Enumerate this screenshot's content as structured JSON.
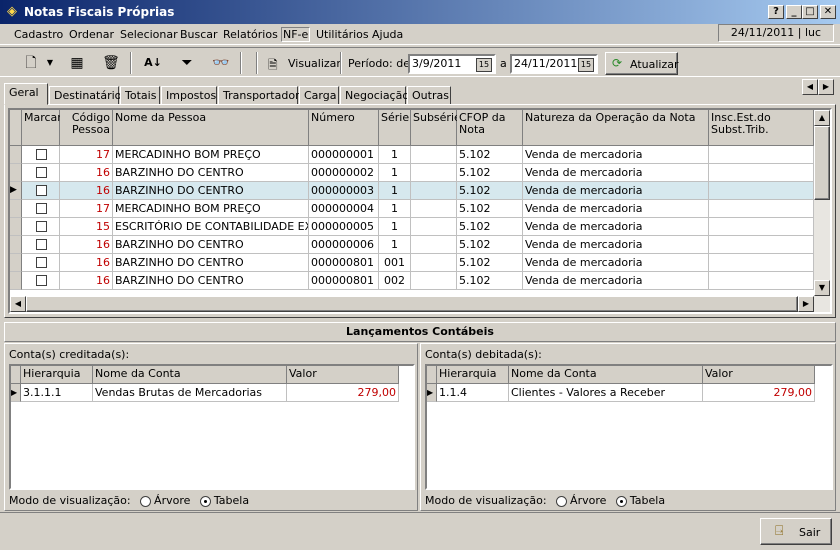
{
  "window": {
    "title": "Notas Fiscais Próprias",
    "status": "24/11/2011 | luc"
  },
  "menu": [
    "Cadastro",
    "Ordenar",
    "Selecionar",
    "Buscar",
    "Relatórios",
    "NF-e",
    "Utilitários",
    "Ajuda"
  ],
  "toolbar": {
    "visualizar": "Visualizar",
    "periodo_label": "Período: de",
    "date_from": "3/9/2011",
    "a_label": "a",
    "date_to": "24/11/2011",
    "atualizar": "Atualizar"
  },
  "tabs": [
    "Geral",
    "Destinatário",
    "Totais",
    "Impostos",
    "Transportador",
    "Carga",
    "Negociação",
    "Outras"
  ],
  "grid": {
    "headers": {
      "marcar": "Marcar",
      "codigo": "Código Pessoa",
      "nome": "Nome da Pessoa",
      "numero": "Número",
      "serie": "Série",
      "subserie": "Subsérie",
      "cfop": "CFOP da Nota",
      "natureza": "Natureza da Operação da Nota",
      "insc": "Insc.Est.do Subst.Trib."
    },
    "rows": [
      {
        "codigo": "17",
        "nome": "MERCADINHO BOM PREÇO",
        "numero": "000000001",
        "serie": "1",
        "subserie": "",
        "cfop": "5.102",
        "natureza": "Venda de mercadoria"
      },
      {
        "codigo": "16",
        "nome": "BARZINHO DO CENTRO",
        "numero": "000000002",
        "serie": "1",
        "subserie": "",
        "cfop": "5.102",
        "natureza": "Venda de mercadoria"
      },
      {
        "codigo": "16",
        "nome": "BARZINHO DO CENTRO",
        "numero": "000000003",
        "serie": "1",
        "subserie": "",
        "cfop": "5.102",
        "natureza": "Venda de mercadoria"
      },
      {
        "codigo": "17",
        "nome": "MERCADINHO BOM PREÇO",
        "numero": "000000004",
        "serie": "1",
        "subserie": "",
        "cfop": "5.102",
        "natureza": "Venda de mercadoria"
      },
      {
        "codigo": "15",
        "nome": "ESCRITÓRIO DE CONTABILIDADE EXEMPLO",
        "numero": "000000005",
        "serie": "1",
        "subserie": "",
        "cfop": "5.102",
        "natureza": "Venda de mercadoria"
      },
      {
        "codigo": "16",
        "nome": "BARZINHO DO CENTRO",
        "numero": "000000006",
        "serie": "1",
        "subserie": "",
        "cfop": "5.102",
        "natureza": "Venda de mercadoria"
      },
      {
        "codigo": "16",
        "nome": "BARZINHO DO CENTRO",
        "numero": "000000801",
        "serie": "001",
        "subserie": "",
        "cfop": "5.102",
        "natureza": "Venda de mercadoria"
      },
      {
        "codigo": "16",
        "nome": "BARZINHO DO CENTRO",
        "numero": "000000801",
        "serie": "002",
        "subserie": "",
        "cfop": "5.102",
        "natureza": "Venda de mercadoria"
      }
    ]
  },
  "lancamentos": {
    "title": "Lançamentos Contábeis",
    "credit": {
      "label": "Conta(s) creditada(s):",
      "headers": [
        "Hierarquia",
        "Nome da Conta",
        "Valor"
      ],
      "row": {
        "hier": "3.1.1.1",
        "nome": "Vendas Brutas de Mercadorias",
        "valor": "279,00"
      }
    },
    "debit": {
      "label": "Conta(s) debitada(s):",
      "headers": [
        "Hierarquia",
        "Nome da Conta",
        "Valor"
      ],
      "row": {
        "hier": "1.1.4",
        "nome": "Clientes - Valores a Receber",
        "valor": "279,00"
      }
    },
    "modo_label": "Modo de visualização:",
    "opt_arvore": "Árvore",
    "opt_tabela": "Tabela"
  },
  "sair": "Sair",
  "colors": {
    "title_start": "#0a246a",
    "title_end": "#a6caf0",
    "code_red": "#c00000",
    "selected_row": "#d6e8ee"
  }
}
